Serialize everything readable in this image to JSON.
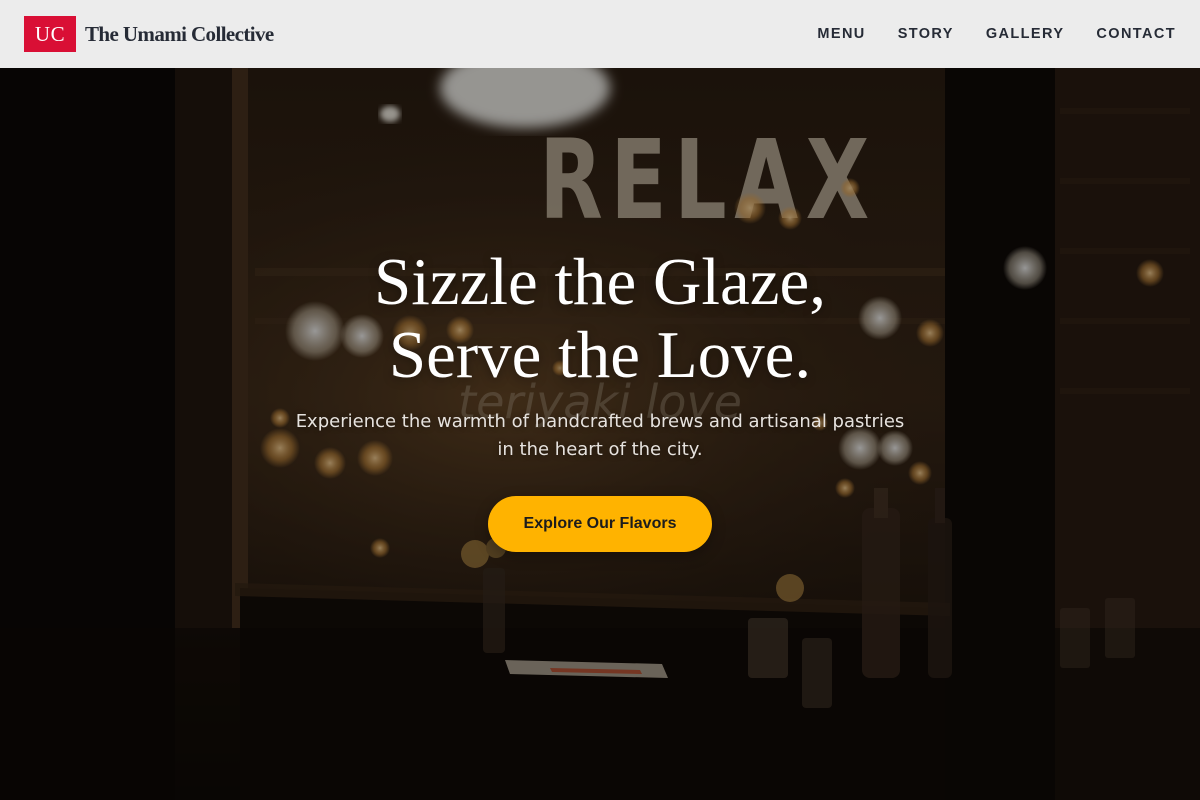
{
  "brand": {
    "mark": "UC",
    "name": "The Umami Collective",
    "accent_color": "#d90f35"
  },
  "nav": {
    "items": [
      {
        "label": "MENU"
      },
      {
        "label": "STORY"
      },
      {
        "label": "GALLERY"
      },
      {
        "label": "CONTACT"
      }
    ]
  },
  "hero": {
    "title_line1": "Sizzle the Glaze,",
    "title_line2": "Serve the Love.",
    "subtitle_line1": "Experience the warmth of handcrafted brews and artisanal pastries",
    "subtitle_line2": "in the heart of the city.",
    "cta_label": "Explore Our Flavors",
    "cta_color": "#ffb300",
    "window_lettering": "RELAX",
    "window_script": "teriyaki love"
  }
}
